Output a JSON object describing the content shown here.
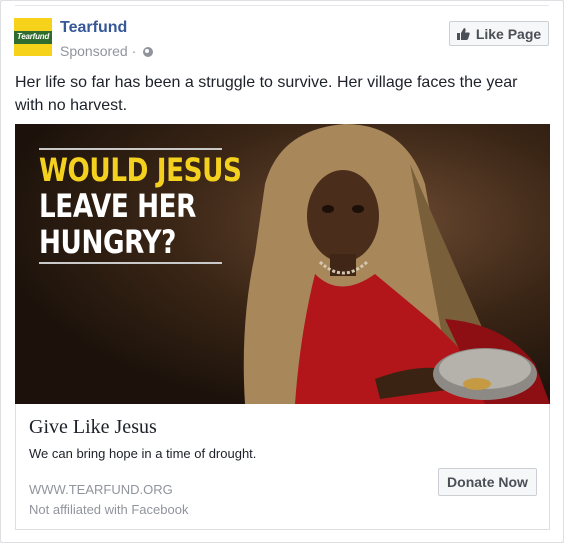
{
  "post": {
    "page_name": "Tearfund",
    "logo_text": "Tearfund",
    "sponsored_label": "Sponsored",
    "separator": " · ",
    "audience_icon": "globe-icon",
    "like_page_label": "Like Page",
    "like_icon": "thumbs-up-icon",
    "text": "Her life so far has been a struggle to survive. Her village faces the year with no harvest."
  },
  "hero": {
    "headline_line1": "WOULD JESUS",
    "headline_line2": "LEAVE HER",
    "headline_line3": "HUNGRY?",
    "colors": {
      "yellow": "#f4d11e",
      "white": "#ffffff"
    }
  },
  "cta": {
    "title": "Give Like Jesus",
    "description": "We can bring hope in a time of drought.",
    "domain": "WWW.TEARFUND.ORG",
    "disclaimer": "Not affiliated with Facebook",
    "button_label": "Donate Now"
  },
  "colors": {
    "link_blue": "#365899",
    "muted": "#90949c",
    "text": "#1d2129",
    "button_bg": "#f6f7f9",
    "border": "#dddfe2"
  }
}
